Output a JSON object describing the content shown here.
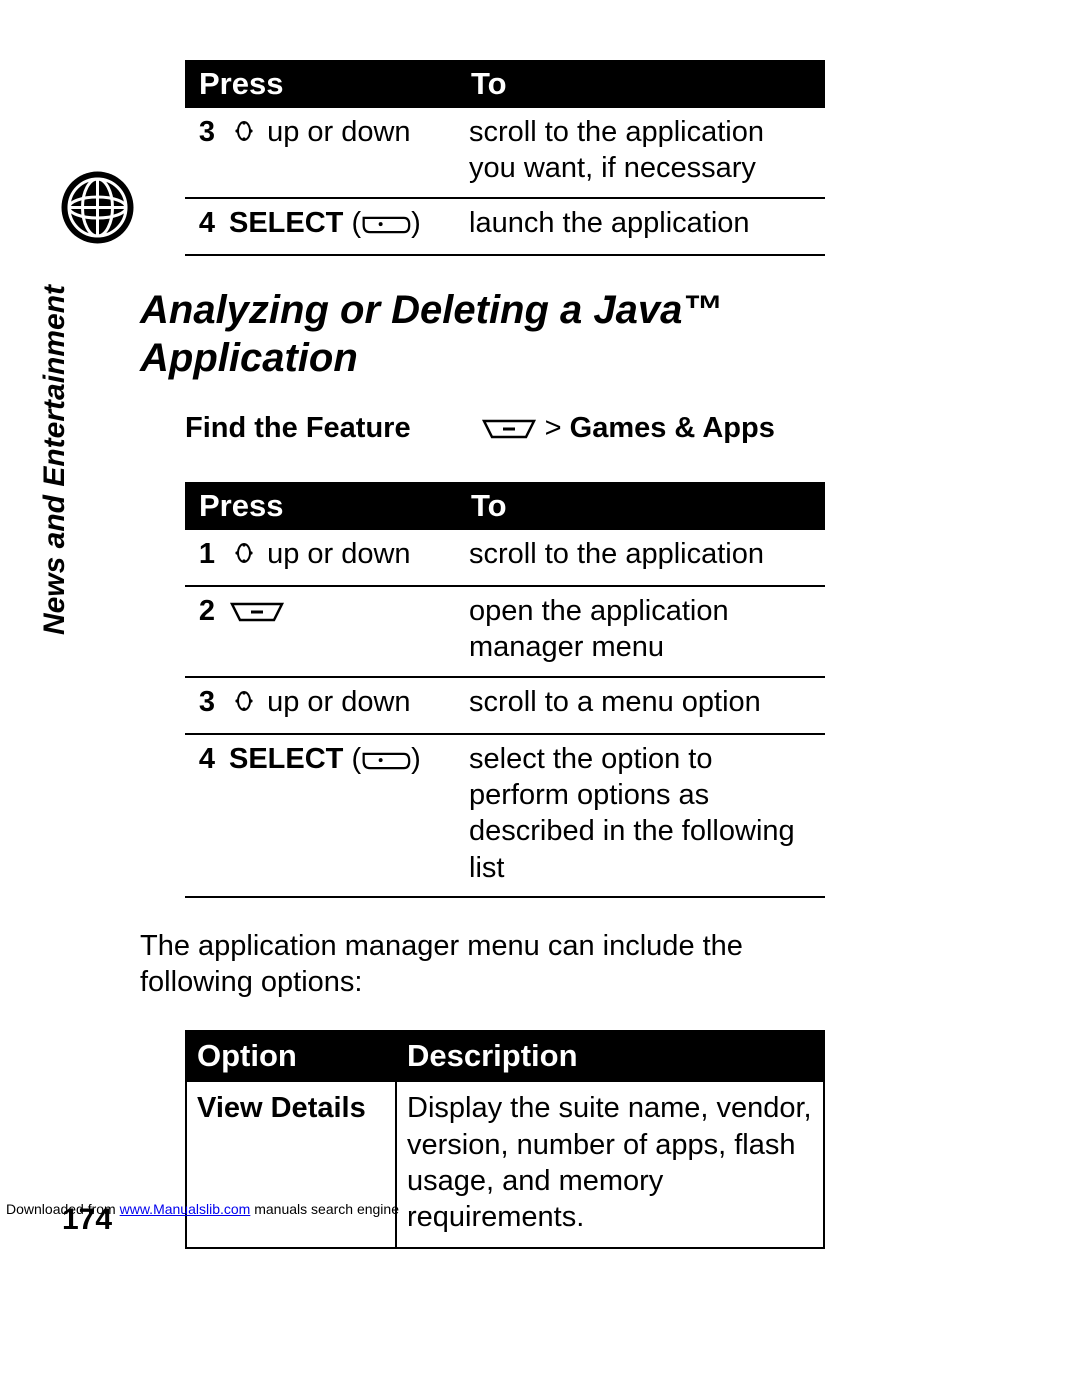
{
  "sideLabel": "News and Entertainment",
  "tableA": {
    "headers": [
      "Press",
      "To"
    ],
    "rows": [
      {
        "num": "3",
        "press_text": "up or down",
        "press_icon": "nav",
        "to": "scroll to the application you want, if necessary"
      },
      {
        "num": "4",
        "press_label": "SELECT",
        "press_icon": "soft",
        "to": "launch the application"
      }
    ]
  },
  "heading": "Analyzing or Deleting a Java™ Application",
  "findFeature": {
    "label": "Find the Feature",
    "path_gt": ">",
    "path_target": "Games & Apps"
  },
  "tableB": {
    "headers": [
      "Press",
      "To"
    ],
    "rows": [
      {
        "num": "1",
        "press_text": "up or down",
        "press_icon": "nav",
        "to": "scroll to the application"
      },
      {
        "num": "2",
        "press_icon": "menu",
        "to": "open the application manager menu"
      },
      {
        "num": "3",
        "press_text": "up or down",
        "press_icon": "nav",
        "to": "scroll to a menu option"
      },
      {
        "num": "4",
        "press_label": "SELECT",
        "press_icon": "soft",
        "to": "select the option to perform options as described in the following list"
      }
    ]
  },
  "bodyText": "The application manager menu can include the following options:",
  "tableC": {
    "headers": [
      "Option",
      "Description"
    ],
    "rows": [
      {
        "option": "View Details",
        "desc": "Display the suite name, vendor, version, number of apps, flash usage, and memory requirements."
      }
    ]
  },
  "pageNumber": "174",
  "footer": {
    "prefix": "Downloaded from ",
    "link": "www.Manualslib.com",
    "suffix": " manuals search engine"
  }
}
